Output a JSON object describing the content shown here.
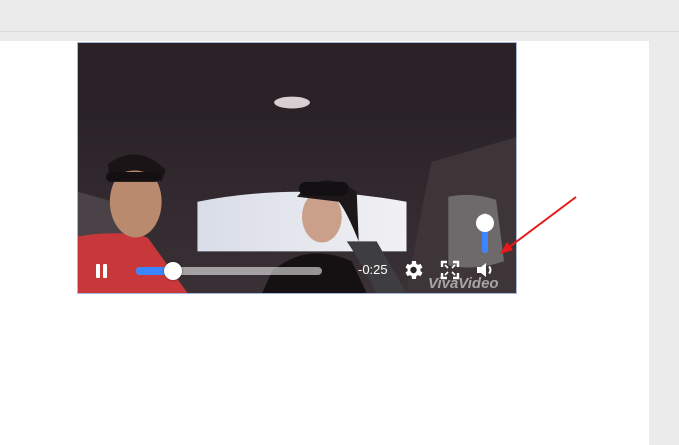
{
  "player": {
    "time_remaining": "-0:25",
    "progress_percent": 20,
    "volume_percent": 75,
    "watermark": "VivaVideo",
    "accent_color": "#3a86ff"
  },
  "icons": {
    "play_pause": "pause-icon",
    "settings": "gear-icon",
    "fullscreen": "fullscreen-icon",
    "volume": "speaker-icon"
  },
  "annotation": {
    "arrow_color": "#e81919"
  }
}
